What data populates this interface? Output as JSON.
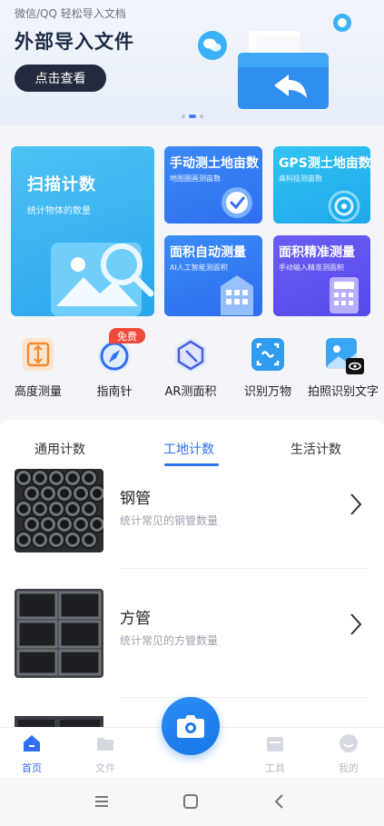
{
  "banner": {
    "subtitle": "微信/QQ 轻松导入文档",
    "title": "外部导入文件",
    "button_label": "点击查看"
  },
  "features": {
    "scan": {
      "title": "扫描计数",
      "subtitle": "统计物体的数量"
    },
    "manual_land": {
      "title": "手动测土地亩数",
      "subtitle": "地图圈画测亩数"
    },
    "gps_land": {
      "title": "GPS测土地亩数",
      "subtitle": "高科技测亩数"
    },
    "auto_area": {
      "title": "面积自动测量",
      "subtitle": "AI人工智能测面积"
    },
    "precise_area": {
      "title": "面积精准测量",
      "subtitle": "手动输入精准测面积"
    }
  },
  "tools": [
    {
      "label": "高度测量",
      "icon": "height-measure-icon"
    },
    {
      "label": "指南针",
      "icon": "compass-icon"
    },
    {
      "label": "AR测面积",
      "icon": "ar-area-icon"
    },
    {
      "label": "识别万物",
      "icon": "recognize-icon"
    },
    {
      "label": "拍照识别文字",
      "icon": "photo-text-icon"
    }
  ],
  "free_badge": "免费",
  "tabs": [
    {
      "label": "通用计数",
      "active": false
    },
    {
      "label": "工地计数",
      "active": true
    },
    {
      "label": "生活计数",
      "active": false
    }
  ],
  "list": [
    {
      "name": "钢管",
      "desc": "统计常见的钢管数量"
    },
    {
      "name": "方管",
      "desc": "统计常见的方管数量"
    }
  ],
  "nav": [
    {
      "label": "首页",
      "icon": "home-icon",
      "active": true
    },
    {
      "label": "文件",
      "icon": "folder-icon",
      "active": false
    },
    {
      "label": "工具",
      "icon": "toolbox-icon",
      "active": false
    },
    {
      "label": "我的",
      "icon": "profile-icon",
      "active": false
    }
  ],
  "colors": {
    "accent": "#2f6ff0",
    "badge_red": "#ef4a3c",
    "banner_button": "#232a3d"
  }
}
